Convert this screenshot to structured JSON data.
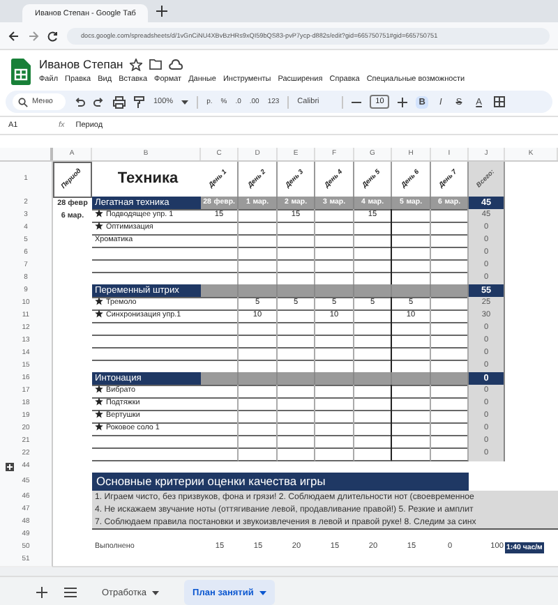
{
  "browser": {
    "tab_title": "Иванов Степан - Google Таб",
    "url": "docs.google.com/spreadsheets/d/1vGnCiNU4XBvBzHRs9xQI59bQS83-pvP7ycp-d882s/edit?gid=665750751#gid=665750751"
  },
  "document": {
    "title": "Иванов Степан",
    "menu": [
      "Файл",
      "Правка",
      "Вид",
      "Вставка",
      "Формат",
      "Данные",
      "Инструменты",
      "Расширения",
      "Справка",
      "Специальные возможности"
    ]
  },
  "toolbar": {
    "search_placeholder": "Меню",
    "zoom": "100%",
    "format_buttons": [
      "р.",
      "%",
      ".0",
      ".00",
      "123"
    ],
    "font": "Calibri",
    "font_size": "10",
    "style_buttons": [
      {
        "label": "B",
        "selected": true
      },
      {
        "label": "I",
        "selected": false
      },
      {
        "label": "S",
        "selected": false
      },
      {
        "label": "A",
        "selected": false
      }
    ]
  },
  "formula_bar": {
    "cell": "A1",
    "function_label": "fx",
    "content": "Период"
  },
  "sheet": {
    "columns": [
      "A",
      "B",
      "C",
      "D",
      "E",
      "F",
      "G",
      "H",
      "I",
      "J",
      "K"
    ],
    "rows": [
      {
        "number": "1",
        "kind": "header",
        "period": "Период",
        "label": "Техника",
        "cells": {
          "C": "День 1",
          "D": "День 2",
          "E": "День 3",
          "F": "День 4",
          "G": "День 5",
          "H": "День 6",
          "I": "День 7"
        },
        "total": "Всего:"
      },
      {
        "number": "2",
        "kind": "section",
        "period": "28 февр",
        "label": "Легатная техника",
        "dates": [
          "28 февр.",
          "1 мар.",
          "2 мар.",
          "3 мар.",
          "4 мар.",
          "5 мар.",
          "6 мар."
        ],
        "cells": {},
        "total": "45"
      },
      {
        "number": "3",
        "kind": "item",
        "period": "6 мар.",
        "starred": true,
        "label": "Подводящее упр. 1",
        "cells": {
          "C": "15",
          "E": "15",
          "G": "15"
        },
        "total": "45"
      },
      {
        "number": "4",
        "kind": "item",
        "starred": true,
        "label": "Оптимизация",
        "cells": {},
        "total": "0"
      },
      {
        "number": "5",
        "kind": "item",
        "starred": false,
        "label": "Хроматика",
        "cells": {},
        "total": "0"
      },
      {
        "number": "6",
        "kind": "item",
        "starred": false,
        "cells": {},
        "total": "0"
      },
      {
        "number": "7",
        "kind": "item",
        "starred": false,
        "cells": {},
        "total": "0"
      },
      {
        "number": "8",
        "kind": "item",
        "starred": false,
        "cells": {},
        "total": "0"
      },
      {
        "number": "9",
        "kind": "section",
        "label": "Переменный штрих",
        "cells": {},
        "total": "55"
      },
      {
        "number": "10",
        "kind": "item",
        "starred": true,
        "label": "Тремоло",
        "cells": {
          "D": "5",
          "E": "5",
          "F": "5",
          "G": "5",
          "H": "5"
        },
        "total": "25"
      },
      {
        "number": "11",
        "kind": "item",
        "starred": true,
        "label": "Синхронизация упр.1",
        "cells": {
          "D": "10",
          "F": "10",
          "H": "10"
        },
        "total": "30"
      },
      {
        "number": "12",
        "kind": "item",
        "starred": false,
        "cells": {},
        "total": "0"
      },
      {
        "number": "13",
        "kind": "item",
        "starred": false,
        "cells": {},
        "total": "0"
      },
      {
        "number": "14",
        "kind": "item",
        "starred": false,
        "cells": {},
        "total": "0"
      },
      {
        "number": "15",
        "kind": "item",
        "starred": false,
        "cells": {},
        "total": "0"
      },
      {
        "number": "16",
        "kind": "section",
        "label": "Интонация",
        "cells": {},
        "total": "0"
      },
      {
        "number": "17",
        "kind": "item",
        "starred": true,
        "label": "Вибрато",
        "cells": {},
        "total": "0"
      },
      {
        "number": "18",
        "kind": "item",
        "starred": true,
        "label": "Подтяжки",
        "cells": {},
        "total": "0"
      },
      {
        "number": "19",
        "kind": "item",
        "starred": true,
        "label": "Вертушки",
        "cells": {},
        "total": "0"
      },
      {
        "number": "20",
        "kind": "item",
        "starred": true,
        "label": "Роковое соло 1",
        "cells": {},
        "total": "0"
      },
      {
        "number": "21",
        "kind": "item",
        "starred": false,
        "cells": {},
        "total": "0"
      },
      {
        "number": "22",
        "kind": "item",
        "starred": false,
        "cells": {},
        "total": "0"
      },
      {
        "number": "44",
        "kind": "blank",
        "grouped": true
      },
      {
        "number": "45",
        "kind": "banner",
        "label": "Основные критерии оценки качества игры"
      },
      {
        "number": "46",
        "kind": "note",
        "label": "1. Играем чисто, без призвуков, фона и грязи! 2. Соблюдаем длительности нот (своевременное"
      },
      {
        "number": "47",
        "kind": "note",
        "label": "4. Не искажаем звучание ноты (оттягивание левой, продавливание правой!) 5. Резкие и амплит"
      },
      {
        "number": "48",
        "kind": "note",
        "label": "7. Соблюдаем правила постановки и звукоизвлечения в левой и правой руке! 8. Следим за синх"
      },
      {
        "number": "49",
        "kind": "blank",
        "grouped": false
      },
      {
        "number": "50",
        "kind": "summary",
        "label": "Выполнено",
        "cells": {
          "C": "15",
          "D": "15",
          "E": "20",
          "F": "15",
          "G": "20",
          "H": "15",
          "I": "0"
        },
        "total": "100",
        "time": "1:40 час/м"
      },
      {
        "number": "51",
        "kind": "blank",
        "grouped": false
      }
    ]
  },
  "sheet_tabs": [
    {
      "label": "Отработка",
      "selected": false
    },
    {
      "label": "План занятий",
      "selected": true
    }
  ]
}
